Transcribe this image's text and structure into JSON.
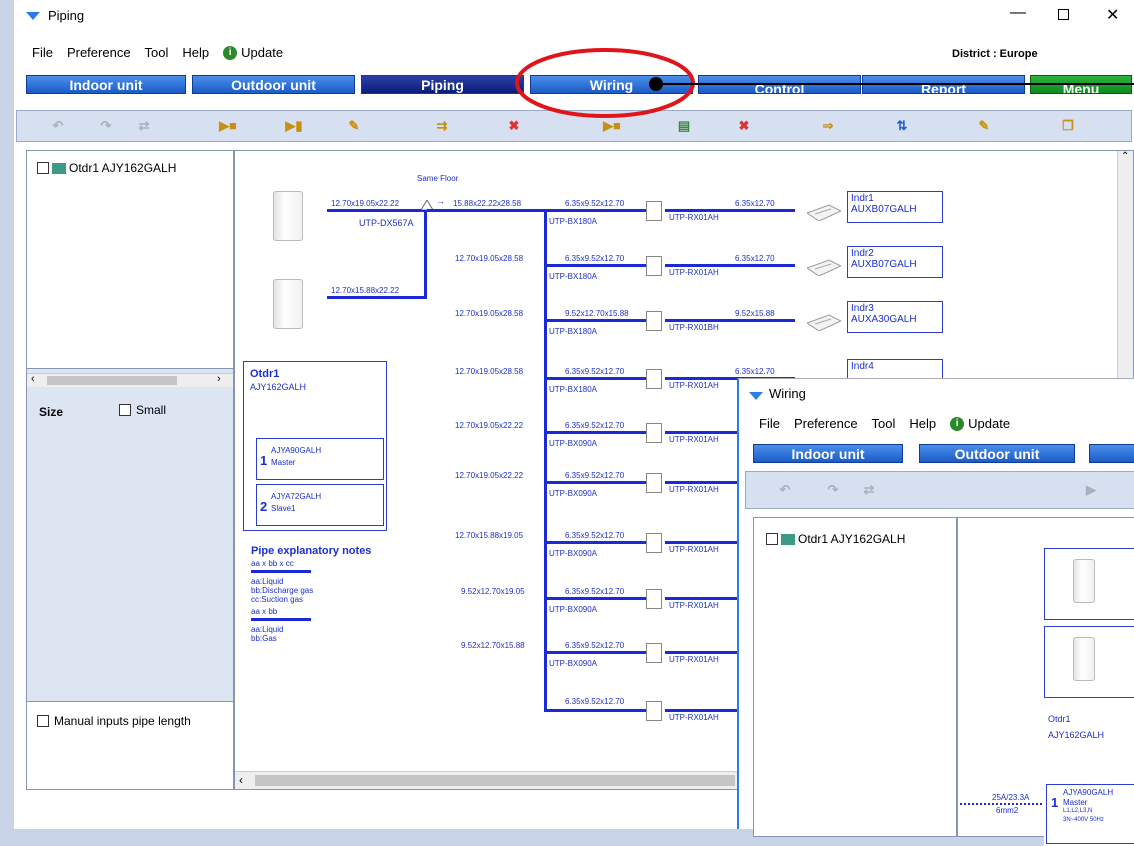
{
  "window": {
    "title": "Piping",
    "district": "District : Europe"
  },
  "menu": {
    "file": "File",
    "preference": "Preference",
    "tool": "Tool",
    "help": "Help",
    "update": "Update"
  },
  "tabs": {
    "indoor": "Indoor unit",
    "outdoor": "Outdoor unit",
    "piping": "Piping",
    "wiring": "Wiring",
    "control": "Control",
    "report": "Report",
    "menu": "Menu"
  },
  "sidebar": {
    "tree_item": "Otdr1 AJY162GALH",
    "size_label": "Size",
    "small_label": "Small",
    "manual_label": "Manual inputs pipe length"
  },
  "diagram": {
    "same_floor": "Same Floor",
    "outdoor_pipe1": "12.70x19.05x22.22",
    "outdoor_pipe2": "12.70x15.88x22.22",
    "separator": "UTP-DX567A",
    "main_pipe": "15.88x22.22x28.58",
    "outdoor_name": "Otdr1",
    "outdoor_model": "AJY162GALH",
    "master_model": "AJYA90GALH",
    "master_num": "1",
    "master_role": "Master",
    "slave_model": "AJYA72GALH",
    "slave_num": "2",
    "slave_role": "Slave1",
    "notes_title": "Pipe explanatory notes",
    "note1": "aa x bb x cc",
    "note1a": "aa:Liquid",
    "note1b": "bb:Discharge gas",
    "note1c": "cc:Suction gas",
    "note2": "aa x bb",
    "note2a": "aa:Liquid",
    "note2b": "bb:Gas",
    "rows": [
      {
        "trunk": "",
        "branch": "6.35x9.52x12.70",
        "header": "UTP-BX180A",
        "joint": "UTP-RX01AH",
        "idu_pipe": "6.35x12.70",
        "name": "Indr1",
        "model": "AUXB07GALH"
      },
      {
        "trunk": "12.70x19.05x28.58",
        "branch": "6.35x9.52x12.70",
        "header": "UTP-BX180A",
        "joint": "UTP-RX01AH",
        "idu_pipe": "6.35x12.70",
        "name": "Indr2",
        "model": "AUXB07GALH"
      },
      {
        "trunk": "12.70x19.05x28.58",
        "branch": "9.52x12.70x15.88",
        "header": "UTP-BX180A",
        "joint": "UTP-RX01BH",
        "idu_pipe": "9.52x15.88",
        "name": "Indr3",
        "model": "AUXA30GALH"
      },
      {
        "trunk": "12.70x19.05x28.58",
        "branch": "6.35x9.52x12.70",
        "header": "UTP-BX180A",
        "joint": "UTP-RX01AH",
        "idu_pipe": "6.35x12.70",
        "name": "Indr4",
        "model": ""
      },
      {
        "trunk": "12.70x19.05x22.22",
        "branch": "6.35x9.52x12.70",
        "header": "UTP-BX090A",
        "joint": "UTP-RX01AH"
      },
      {
        "trunk": "12.70x19.05x22.22",
        "branch": "6.35x9.52x12.70",
        "header": "UTP-BX090A",
        "joint": "UTP-RX01AH"
      },
      {
        "trunk": "12.70x15.88x19.05",
        "branch": "6.35x9.52x12.70",
        "header": "UTP-BX090A",
        "joint": "UTP-RX01AH"
      },
      {
        "trunk": "9.52x12.70x19.05",
        "branch": "6.35x9.52x12.70",
        "header": "UTP-BX090A",
        "joint": "UTP-RX01AH"
      },
      {
        "trunk": "9.52x12.70x15.88",
        "branch": "6.35x9.52x12.70",
        "header": "UTP-BX090A",
        "joint": "UTP-RX01AH"
      },
      {
        "trunk": "",
        "branch": "6.35x9.52x12.70",
        "header": "",
        "joint": "UTP-RX01AH"
      }
    ]
  },
  "wiring": {
    "title": "Wiring",
    "tree_item": "Otdr1 AJY162GALH",
    "outdoor_name": "Otdr1",
    "outdoor_model": "AJY162GALH",
    "cable_spec": "25A/23.3A",
    "cable_size": "6mm2",
    "master_num": "1",
    "master_model": "AJYA90GALH",
    "master_role": "Master",
    "master_terminals": "L1,L2,L3,N",
    "master_power": "3N~400V 50Hz"
  },
  "colors": {
    "accent": "#1b5bc8",
    "annotation": "#e0141b",
    "diagram_line": "#1b2ad6"
  }
}
